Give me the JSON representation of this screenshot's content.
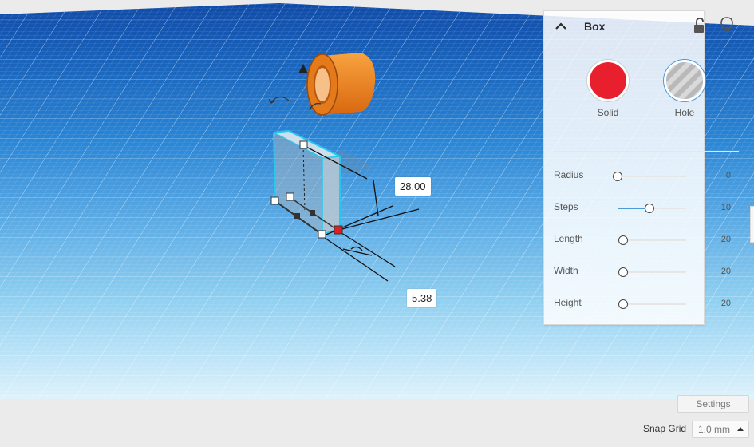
{
  "dimensions": {
    "top_value": "28.00",
    "bottom_value": "5.38"
  },
  "inspector": {
    "title": "Box",
    "solid_label": "Solid",
    "hole_label": "Hole",
    "solid_color": "#e8202d",
    "params": [
      {
        "label": "Radius",
        "value": "0",
        "slider_fraction": 0.0
      },
      {
        "label": "Steps",
        "value": "10",
        "slider_fraction": 0.46
      },
      {
        "label": "Length",
        "value": "20",
        "slider_fraction": 0.08
      },
      {
        "label": "Width",
        "value": "20",
        "slider_fraction": 0.08
      },
      {
        "label": "Height",
        "value": "20",
        "slider_fraction": 0.08
      }
    ]
  },
  "bottom_bar": {
    "settings_label": "Settings",
    "snap_grid_label": "Snap Grid",
    "snap_grid_value": "1.0 mm"
  },
  "icons": [
    "chevron-up-icon",
    "unlock-icon",
    "lightbulb-icon",
    "rotate-arrow-icon",
    "lift-arrow-icon"
  ],
  "colors": {
    "accent": "#4d9bd6",
    "workplane": "#1a72c8",
    "box_outline": "#29c7f0",
    "cylinder": "#f08020",
    "selected_handle": "#e02020"
  }
}
